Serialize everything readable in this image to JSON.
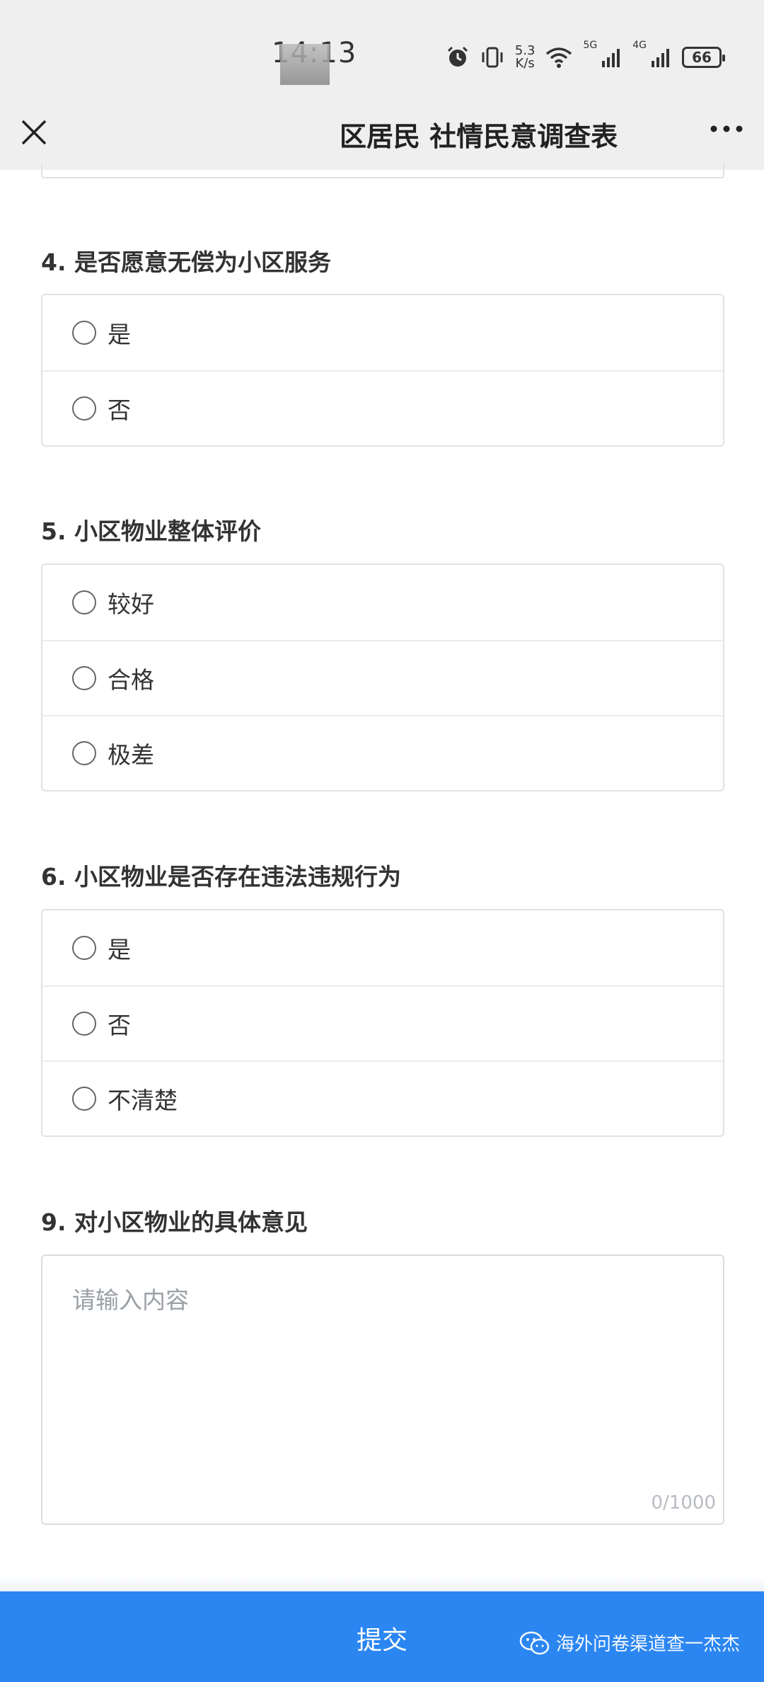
{
  "status_bar": {
    "time": "14:13",
    "net_speed_value": "5.3",
    "net_speed_unit": "K/s",
    "sig1_label": "5G",
    "sig2_label": "4G",
    "battery": "66"
  },
  "nav": {
    "title": "区居民 社情民意调查表"
  },
  "questions": [
    {
      "title": "4. 是否愿意无偿为小区服务",
      "options": [
        "是",
        "否"
      ]
    },
    {
      "title": "5. 小区物业整体评价",
      "options": [
        "较好",
        "合格",
        "极差"
      ]
    },
    {
      "title": "6. 小区物业是否存在违法违规行为",
      "options": [
        "是",
        "否",
        "不清楚"
      ]
    },
    {
      "title": "9. 对小区物业的具体意见",
      "placeholder": "请输入内容",
      "char_count": "0/1000"
    }
  ],
  "submit_label": "提交",
  "watermark_text": "海外问卷渠道查一杰杰",
  "colors": {
    "accent": "#2b86f1",
    "background": "#ffffff",
    "chrome": "#efefef"
  }
}
